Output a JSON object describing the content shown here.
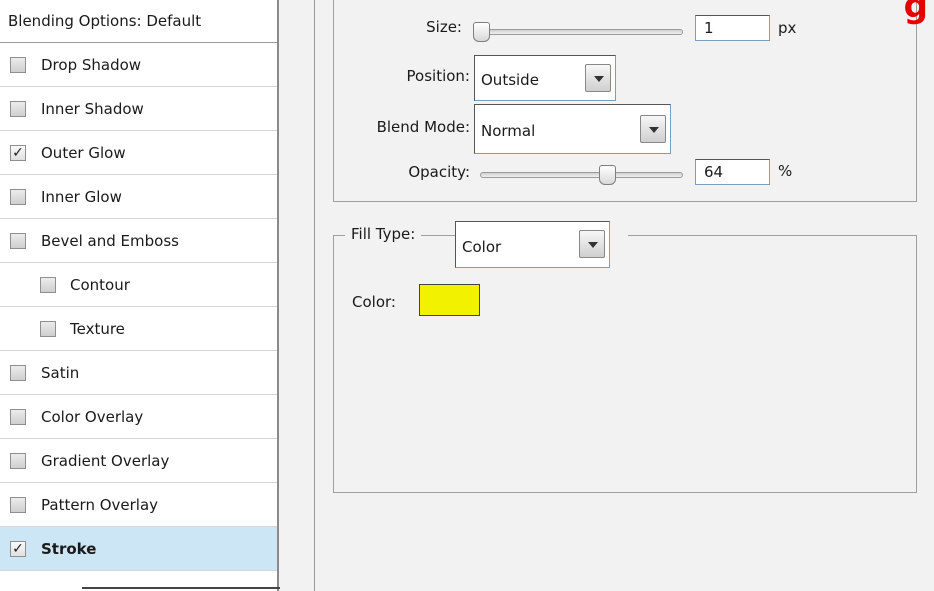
{
  "sidebar": {
    "header": "Blending Options: Default",
    "items": [
      {
        "label": "Drop Shadow",
        "checked": false,
        "sub": false,
        "selected": false,
        "name": "drop-shadow"
      },
      {
        "label": "Inner Shadow",
        "checked": false,
        "sub": false,
        "selected": false,
        "name": "inner-shadow"
      },
      {
        "label": "Outer Glow",
        "checked": true,
        "sub": false,
        "selected": false,
        "name": "outer-glow"
      },
      {
        "label": "Inner Glow",
        "checked": false,
        "sub": false,
        "selected": false,
        "name": "inner-glow"
      },
      {
        "label": "Bevel and Emboss",
        "checked": false,
        "sub": false,
        "selected": false,
        "name": "bevel-and-emboss"
      },
      {
        "label": "Contour",
        "checked": false,
        "sub": true,
        "selected": false,
        "name": "contour"
      },
      {
        "label": "Texture",
        "checked": false,
        "sub": true,
        "selected": false,
        "name": "texture"
      },
      {
        "label": "Satin",
        "checked": false,
        "sub": false,
        "selected": false,
        "name": "satin"
      },
      {
        "label": "Color Overlay",
        "checked": false,
        "sub": false,
        "selected": false,
        "name": "color-overlay"
      },
      {
        "label": "Gradient Overlay",
        "checked": false,
        "sub": false,
        "selected": false,
        "name": "gradient-overlay"
      },
      {
        "label": "Pattern Overlay",
        "checked": false,
        "sub": false,
        "selected": false,
        "name": "pattern-overlay"
      },
      {
        "label": "Stroke",
        "checked": true,
        "sub": false,
        "selected": true,
        "name": "stroke"
      }
    ],
    "check_glyph": "✓"
  },
  "structure": {
    "size_label": "Size:",
    "size_value": "1",
    "size_unit": "px",
    "position_label": "Position:",
    "position_value": "Outside",
    "blend_mode_label": "Blend Mode:",
    "blend_mode_value": "Normal",
    "opacity_label": "Opacity:",
    "opacity_value": "64",
    "opacity_unit": "%"
  },
  "fill": {
    "fill_type_label": "Fill Type:",
    "fill_type_value": "Color",
    "color_label": "Color:",
    "color_hex": "#f2f200"
  },
  "overlay": {
    "red_text": "g"
  },
  "icons": {
    "dropdown": "chevron-down-icon",
    "checkbox": "checkbox-icon"
  }
}
